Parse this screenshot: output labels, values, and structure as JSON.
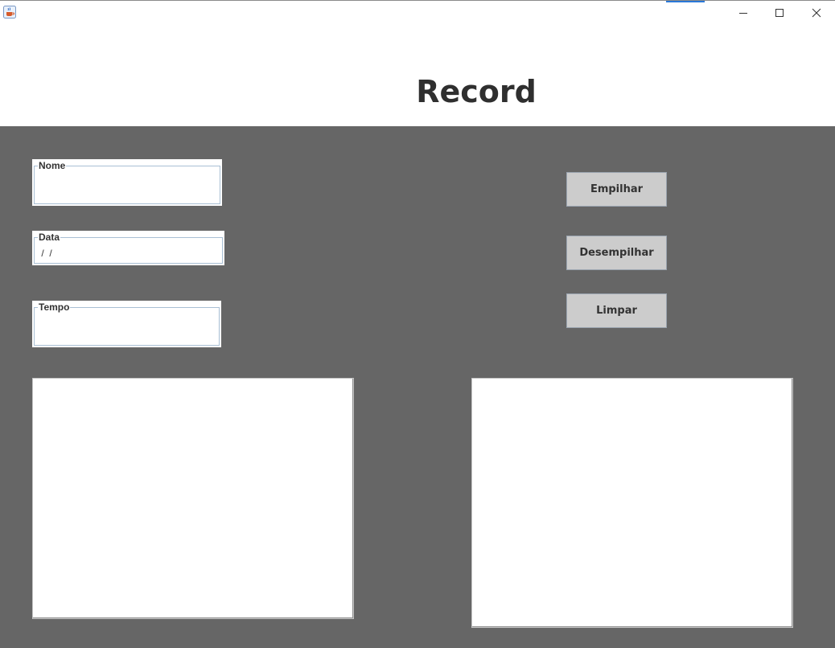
{
  "window": {
    "icon": "java-cup-icon",
    "controls": [
      "minimize-icon",
      "maximize-icon",
      "close-icon"
    ],
    "accent_color": "#2a78d8"
  },
  "header": {
    "title": "Record"
  },
  "form": {
    "nome": {
      "label": "Nome",
      "value": ""
    },
    "data": {
      "label": "Data",
      "value": " /  /"
    },
    "tempo": {
      "label": "Tempo",
      "value": ""
    }
  },
  "actions": {
    "empilhar": "Empilhar",
    "desempilhar": "Desempilhar",
    "limpar": "Limpar"
  },
  "outputs": {
    "left_text": "",
    "right_text": ""
  },
  "colors": {
    "content_background": "#666666",
    "button_background": "#cccccc",
    "title_color": "#2f2f2f"
  }
}
